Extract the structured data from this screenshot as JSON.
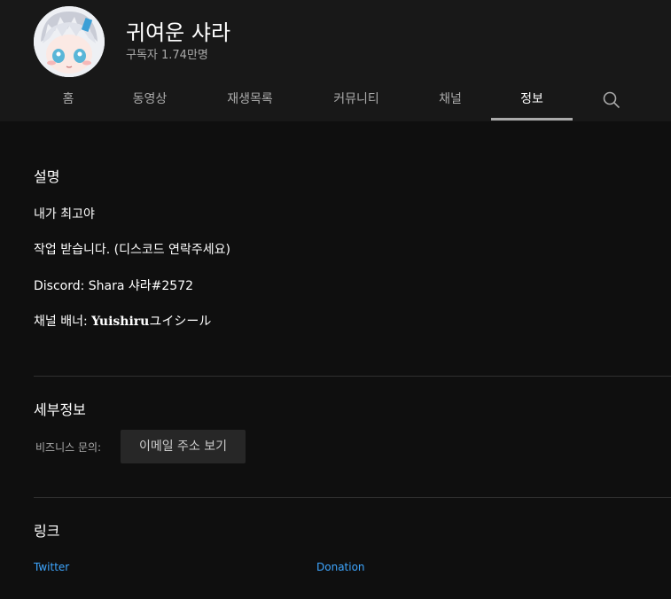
{
  "channel": {
    "name": "귀여운 샤라",
    "subscribers": "구독자 1.74만명"
  },
  "tabs": [
    {
      "label": "홈"
    },
    {
      "label": "동영상"
    },
    {
      "label": "재생목록"
    },
    {
      "label": "커뮤니티"
    },
    {
      "label": "채널"
    },
    {
      "label": "정보",
      "active": true
    }
  ],
  "description": {
    "title": "설명",
    "lines": [
      "내가 최고야",
      "작업 받습니다. (디스코드 연락주세요)",
      "Discord: Shara 샤라#2572"
    ],
    "banner_prefix": "채널 배너: ",
    "banner_name": "Yuishiru",
    "banner_suffix": "ユイシール"
  },
  "details": {
    "title": "세부정보",
    "business_label": "비즈니스 문의:",
    "email_button": "이메일 주소 보기"
  },
  "links": {
    "title": "링크",
    "items": [
      "Twitter",
      "Donation"
    ]
  },
  "colors": {
    "background": "#0f0f0f",
    "header": "#181818",
    "link": "#3ea6ff"
  }
}
